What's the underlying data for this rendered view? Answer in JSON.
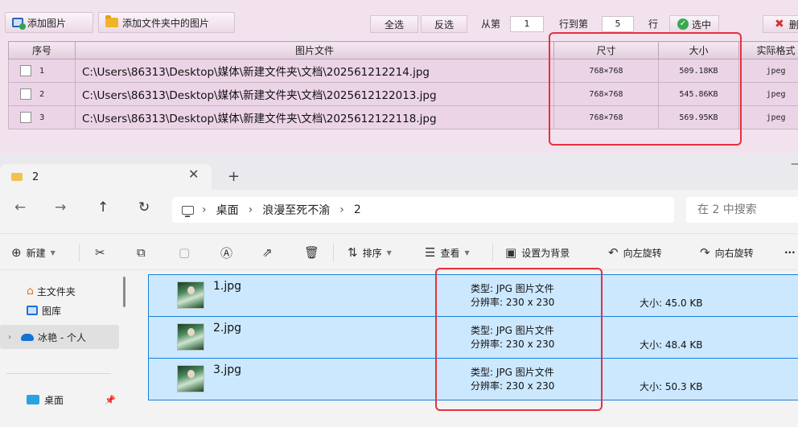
{
  "toolbar": {
    "add_image": "添加图片",
    "add_folder_images": "添加文件夹中的图片",
    "select_all": "全选",
    "invert": "反选",
    "from_label": "从第",
    "from_value": "1",
    "to_label": "行到第",
    "to_value": "5",
    "row_label": "行",
    "select_label": "选中",
    "delete_label": "删"
  },
  "grid": {
    "headers": [
      "序号",
      "图片文件",
      "尺寸",
      "大小",
      "实际格式"
    ],
    "rows": [
      {
        "seq": "1",
        "path": "C:\\Users\\86313\\Desktop\\媒体\\新建文件夹\\文档\\202561212214.jpg",
        "dims": "768×768",
        "size": "509.18KB",
        "fmt": "jpeg"
      },
      {
        "seq": "2",
        "path": "C:\\Users\\86313\\Desktop\\媒体\\新建文件夹\\文档\\2025612122013.jpg",
        "dims": "768×768",
        "size": "545.86KB",
        "fmt": "jpeg"
      },
      {
        "seq": "3",
        "path": "C:\\Users\\86313\\Desktop\\媒体\\新建文件夹\\文档\\2025612122118.jpg",
        "dims": "768×768",
        "size": "569.95KB",
        "fmt": "jpeg"
      }
    ]
  },
  "explorer": {
    "tab_title": "2",
    "breadcrumb": [
      "桌面",
      "浪漫至死不渝",
      "2"
    ],
    "search_placeholder": "在 2 中搜索",
    "commands": {
      "new": "新建",
      "sort": "排序",
      "view": "查看",
      "set_bg": "设置为背景",
      "rotate_left": "向左旋转",
      "rotate_right": "向右旋转"
    },
    "sidebar": [
      {
        "label": "主文件夹",
        "icon": "home-icon"
      },
      {
        "label": "图库",
        "icon": "gallery-icon"
      },
      {
        "label": "冰艳 - 个人",
        "icon": "onedrive-icon"
      },
      {
        "label": "桌面",
        "icon": "desktop-icon"
      }
    ],
    "files": [
      {
        "name": "1.jpg",
        "type": "类型: JPG 图片文件",
        "resolution": "分辨率: 230 x 230",
        "size": "大小: 45.0 KB"
      },
      {
        "name": "2.jpg",
        "type": "类型: JPG 图片文件",
        "resolution": "分辨率: 230 x 230",
        "size": "大小: 48.4 KB"
      },
      {
        "name": "3.jpg",
        "type": "类型: JPG 图片文件",
        "resolution": "分辨率: 230 x 230",
        "size": "大小: 50.3 KB"
      }
    ]
  },
  "colors": {
    "app_bg": "#f2e2ee",
    "highlight_box": "#e8303d",
    "selection_bg": "#cce8ff",
    "selection_border": "#1a7fd6"
  }
}
